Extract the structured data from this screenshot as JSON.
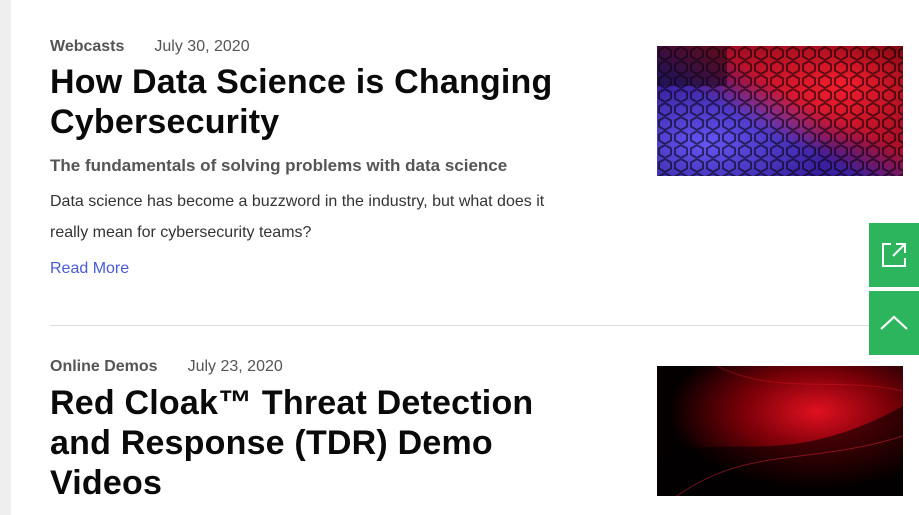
{
  "articles": [
    {
      "category": "Webcasts",
      "date": "July 30, 2020",
      "title_line1": "How Data Science is Changing",
      "title_line2": "Cybersecurity",
      "subtitle": "The fundamentals of solving problems with data science",
      "summary_line1": "Data science has become a buzzword in the industry, but what does it",
      "summary_line2": "really mean for cybersecurity teams?",
      "read_more": "Read More",
      "thumbnail": "hexagon-pattern-red-purple"
    },
    {
      "category": "Online Demos",
      "date": "July 23, 2020",
      "title_line1": "Red Cloak™ Threat Detection",
      "title_line2": "and Response (TDR) Demo",
      "title_line3": "Videos",
      "thumbnail": "red-wave-dark"
    }
  ],
  "floating_actions": {
    "share_icon": "external-link-icon",
    "top_icon": "chevron-up-icon",
    "color": "#2db55d"
  }
}
